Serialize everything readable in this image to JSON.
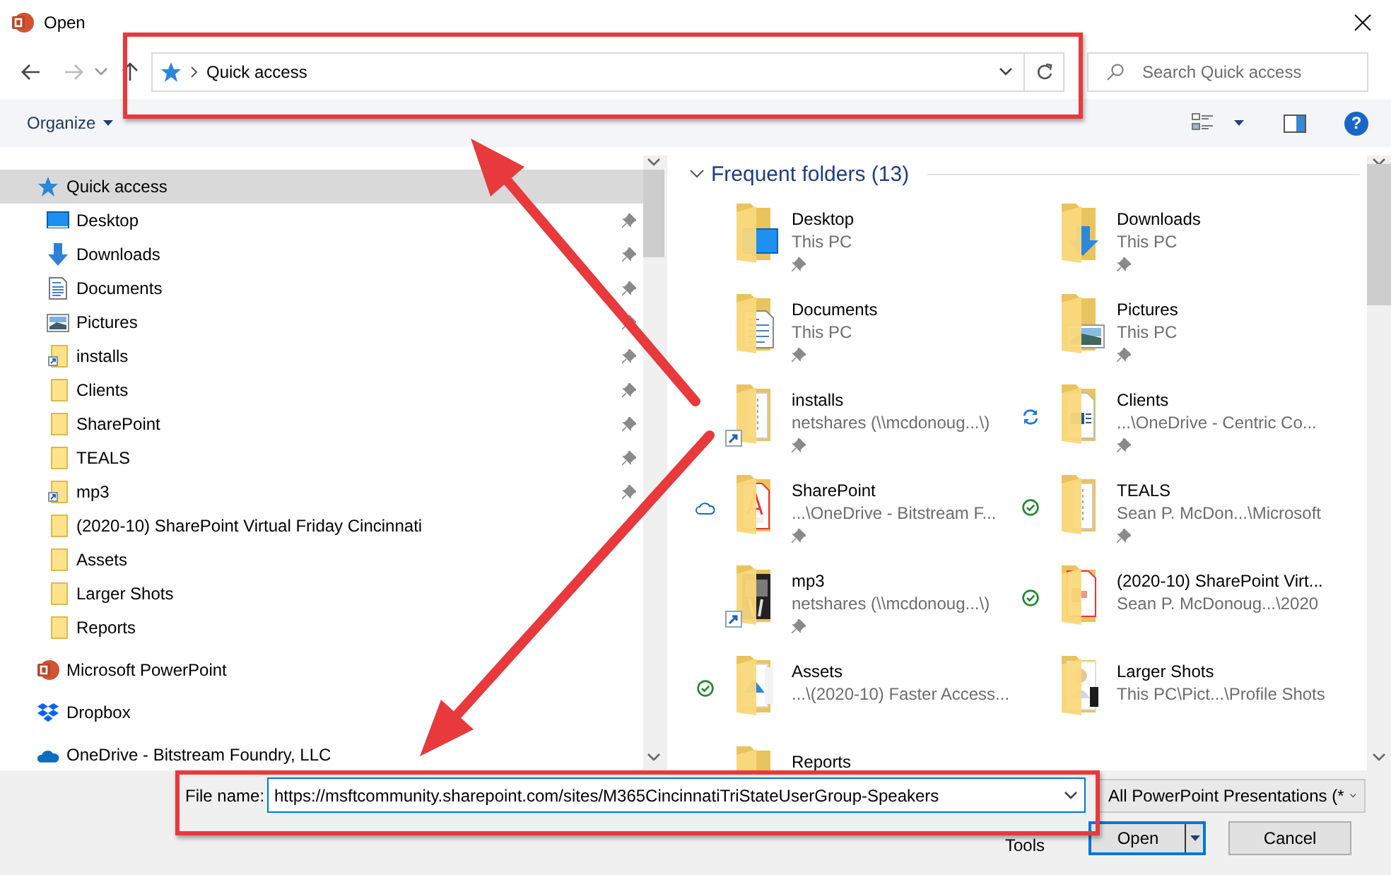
{
  "window": {
    "title": "Open"
  },
  "navigation": {
    "path": "Quick access"
  },
  "search": {
    "placeholder": "Search Quick access"
  },
  "toolbar": {
    "organize": "Organize",
    "help": "?"
  },
  "nav_pane": {
    "items": [
      {
        "label": "Quick access",
        "kind": "quick-access",
        "selected": true,
        "children": [
          {
            "label": "Desktop",
            "kind": "desktop",
            "selected": false,
            "pinned": true
          },
          {
            "label": "Downloads",
            "kind": "downloads",
            "selected": false,
            "pinned": true
          },
          {
            "label": "Documents",
            "kind": "documents",
            "selected": false,
            "pinned": true
          },
          {
            "label": "Pictures",
            "kind": "pictures",
            "selected": false,
            "pinned": true
          },
          {
            "label": "installs",
            "kind": "shortcut-folder",
            "selected": false,
            "pinned": true
          },
          {
            "label": "Clients",
            "kind": "folder",
            "selected": false,
            "pinned": true
          },
          {
            "label": "SharePoint",
            "kind": "folder",
            "selected": false,
            "pinned": true
          },
          {
            "label": "TEALS",
            "kind": "folder",
            "selected": false,
            "pinned": true
          },
          {
            "label": "mp3",
            "kind": "shortcut-folder",
            "selected": false,
            "pinned": true
          },
          {
            "label": "(2020-10) SharePoint Virtual Friday Cincinnati",
            "kind": "folder",
            "selected": false,
            "pinned": false
          },
          {
            "label": "Assets",
            "kind": "folder",
            "selected": false,
            "pinned": false
          },
          {
            "label": "Larger Shots",
            "kind": "folder",
            "selected": false,
            "pinned": false
          },
          {
            "label": "Reports",
            "kind": "folder",
            "selected": false,
            "pinned": false
          }
        ]
      },
      {
        "label": "Microsoft PowerPoint",
        "kind": "powerpoint",
        "selected": false
      },
      {
        "label": "Dropbox",
        "kind": "dropbox",
        "selected": false
      },
      {
        "label": "OneDrive - Bitstream Foundry, LLC",
        "kind": "onedrive",
        "selected": false
      }
    ]
  },
  "frequent_folders": {
    "title": "Frequent folders (13)",
    "expanded": true,
    "items": [
      {
        "name": "Desktop",
        "location": "This PC",
        "kind": "desktop",
        "shortcut": false,
        "pinned": true,
        "synced": false,
        "syncing": false,
        "online_only": false
      },
      {
        "name": "Downloads",
        "location": "This PC",
        "kind": "downloads",
        "shortcut": false,
        "pinned": true,
        "synced": false,
        "syncing": false,
        "online_only": false
      },
      {
        "name": "Documents",
        "location": "This PC",
        "kind": "documents",
        "shortcut": false,
        "pinned": true,
        "synced": false,
        "syncing": false,
        "online_only": false
      },
      {
        "name": "Pictures",
        "location": "This PC",
        "kind": "pictures",
        "shortcut": false,
        "pinned": true,
        "synced": false,
        "syncing": false,
        "online_only": false
      },
      {
        "name": "installs",
        "location": "netshares (\\\\mcdonoug...\\)",
        "kind": "files",
        "shortcut": true,
        "pinned": true,
        "synced": false,
        "syncing": false,
        "online_only": false
      },
      {
        "name": "Clients",
        "location": "...\\OneDrive - Centric Co...",
        "kind": "word",
        "shortcut": false,
        "pinned": true,
        "synced": false,
        "syncing": true,
        "online_only": false
      },
      {
        "name": "SharePoint",
        "location": "...\\OneDrive - Bitstream F...",
        "kind": "pdf",
        "shortcut": false,
        "pinned": true,
        "synced": false,
        "syncing": false,
        "online_only": true
      },
      {
        "name": "TEALS",
        "location": "Sean P. McDon...\\Microsoft",
        "kind": "files",
        "shortcut": false,
        "pinned": true,
        "synced": true,
        "syncing": false,
        "online_only": false
      },
      {
        "name": "mp3",
        "location": "netshares (\\\\mcdonoug...\\)",
        "kind": "album",
        "shortcut": true,
        "pinned": true,
        "synced": false,
        "syncing": false,
        "online_only": false
      },
      {
        "name": "(2020-10) SharePoint Virt...",
        "location": "Sean P. McDonoug...\\2020",
        "kind": "presentation",
        "shortcut": false,
        "pinned": false,
        "synced": true,
        "syncing": false,
        "online_only": false
      },
      {
        "name": "Assets",
        "location": "...\\(2020-10) Faster Access...",
        "kind": "photos",
        "shortcut": false,
        "pinned": false,
        "synced": true,
        "syncing": false,
        "online_only": false
      },
      {
        "name": "Larger Shots",
        "location": "This PC\\Pict...\\Profile Shots",
        "kind": "portrait",
        "shortcut": false,
        "pinned": false,
        "synced": false,
        "syncing": false,
        "online_only": false
      },
      {
        "name": "Reports",
        "kind": "plain"
      }
    ]
  },
  "footer": {
    "file_name_label": "File name:",
    "file_name": "https://msftcommunity.sharepoint.com/sites/M365CincinnatiTriStateUserGroup-Speakers",
    "file_type": "All PowerPoint Presentations (*",
    "tools": "Tools",
    "buttons": [
      {
        "label": "Open",
        "kind": "split",
        "default": true
      },
      {
        "label": "Cancel",
        "kind": "plain",
        "default": false
      }
    ]
  }
}
